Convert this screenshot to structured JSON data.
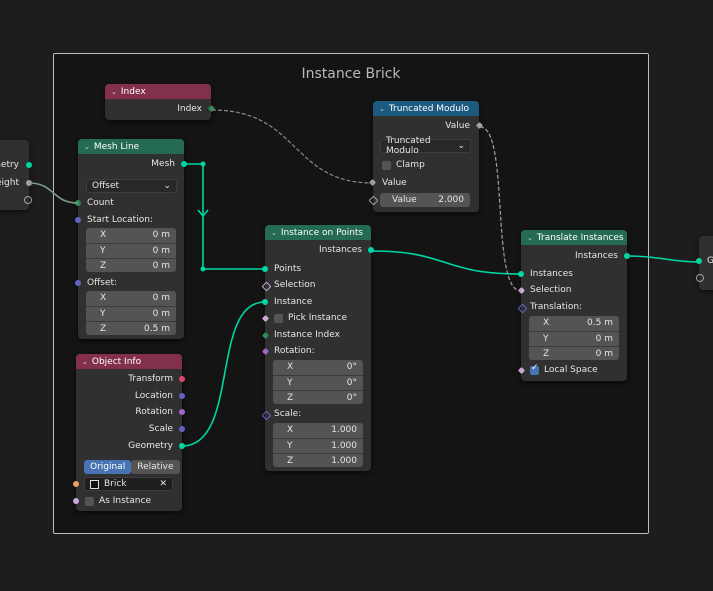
{
  "frame": {
    "title": "Instance Brick"
  },
  "left_node": {
    "outputs": [
      "metry",
      "eight"
    ]
  },
  "index_node": {
    "title": "Index",
    "output": "Index"
  },
  "mesh_line": {
    "title": "Mesh Line",
    "output": "Mesh",
    "mode": "Offset",
    "count": "Count",
    "start_location": "Start Location:",
    "start": {
      "x_label": "X",
      "x": "0 m",
      "y_label": "Y",
      "y": "0 m",
      "z_label": "Z",
      "z": "0 m"
    },
    "offset_label": "Offset:",
    "offset": {
      "x_label": "X",
      "x": "0 m",
      "y_label": "Y",
      "y": "0 m",
      "z_label": "Z",
      "z": "0.5 m"
    }
  },
  "object_info": {
    "title": "Object Info",
    "outputs": [
      "Transform",
      "Location",
      "Rotation",
      "Scale",
      "Geometry"
    ],
    "mode_original": "Original",
    "mode_relative": "Relative",
    "object": "Brick",
    "as_instance": "As Instance"
  },
  "truncated_modulo": {
    "title": "Truncated Modulo",
    "output": "Value",
    "operation": "Truncated Modulo",
    "clamp": "Clamp",
    "input_value": "Value",
    "value_label": "Value",
    "value": "2.000"
  },
  "instance_on_points": {
    "title": "Instance on Points",
    "output": "Instances",
    "points": "Points",
    "selection": "Selection",
    "instance": "Instance",
    "pick_instance": "Pick Instance",
    "instance_index": "Instance Index",
    "rotation_label": "Rotation:",
    "rotation": {
      "x_label": "X",
      "x": "0°",
      "y_label": "Y",
      "y": "0°",
      "z_label": "Z",
      "z": "0°"
    },
    "scale_label": "Scale:",
    "scale": {
      "x_label": "X",
      "x": "1.000",
      "y_label": "Y",
      "y": "1.000",
      "z_label": "Z",
      "z": "1.000"
    }
  },
  "translate_instances": {
    "title": "Translate Instances",
    "output": "Instances",
    "instances": "Instances",
    "selection": "Selection",
    "translation_label": "Translation:",
    "translation": {
      "x_label": "X",
      "x": "0.5 m",
      "y_label": "Y",
      "y": "0 m",
      "z_label": "Z",
      "z": "0 m"
    },
    "local_space": "Local Space"
  },
  "right_node": {
    "input": "G"
  }
}
